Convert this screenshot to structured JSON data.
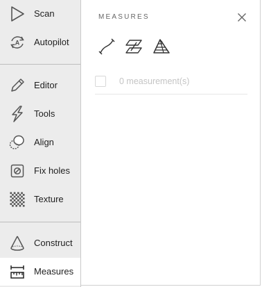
{
  "sidebar": {
    "items": [
      {
        "id": "scan",
        "label": "Scan",
        "icon": "triangle-play-icon"
      },
      {
        "id": "autopilot",
        "label": "Autopilot",
        "icon": "autopilot-icon"
      },
      {
        "id": "editor",
        "label": "Editor",
        "icon": "pencil-icon"
      },
      {
        "id": "tools",
        "label": "Tools",
        "icon": "lightning-icon"
      },
      {
        "id": "align",
        "label": "Align",
        "icon": "align-icon"
      },
      {
        "id": "fix_holes",
        "label": "Fix holes",
        "icon": "fix-holes-icon"
      },
      {
        "id": "texture",
        "label": "Texture",
        "icon": "checkerboard-icon"
      },
      {
        "id": "construct",
        "label": "Construct",
        "icon": "cone-icon"
      },
      {
        "id": "measures",
        "label": "Measures",
        "icon": "ruler-icon"
      }
    ],
    "active": "measures"
  },
  "panel": {
    "title": "MEASURES",
    "tools": [
      {
        "id": "curve",
        "icon": "curve-measure-icon"
      },
      {
        "id": "section",
        "icon": "section-measure-icon"
      },
      {
        "id": "volume",
        "icon": "volume-measure-icon"
      }
    ],
    "measurement_label": "0 measurement(s)",
    "close_icon": "close-icon"
  },
  "colors": {
    "sidebar_bg": "#ececec",
    "active_bg": "#ffffff",
    "text": "#1f1f1f",
    "muted_text": "#c4c4c4",
    "icon_stroke": "#555555"
  }
}
